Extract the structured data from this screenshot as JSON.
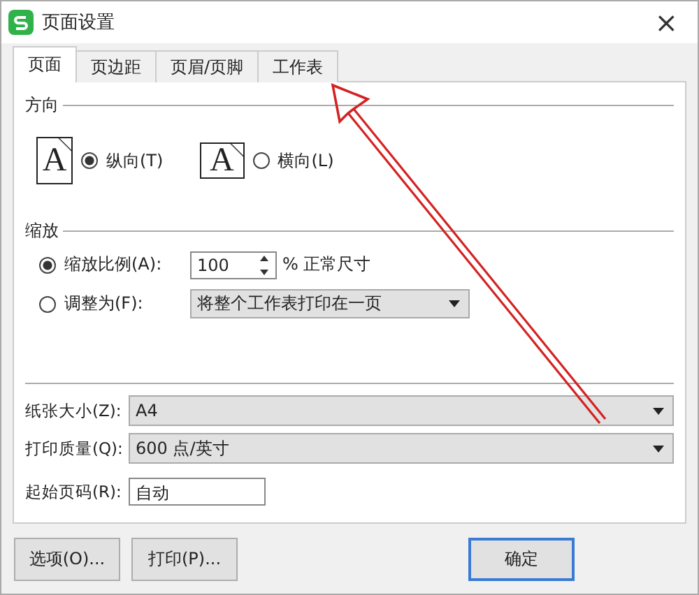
{
  "window": {
    "title": "页面设置",
    "close": "×"
  },
  "tabs": [
    {
      "label": "页面",
      "selected": true
    },
    {
      "label": "页边距",
      "selected": false
    },
    {
      "label": "页眉/页脚",
      "selected": false
    },
    {
      "label": "工作表",
      "selected": false
    }
  ],
  "orientation": {
    "title": "方向",
    "options": [
      {
        "kind": "portrait",
        "glyph": "A",
        "label": "纵向(T)",
        "selected": true
      },
      {
        "kind": "landscape",
        "glyph": "A",
        "label": "横向(L)",
        "selected": false
      }
    ]
  },
  "scaling": {
    "title": "缩放",
    "options": [
      {
        "kind": "percent",
        "label": "缩放比例(A):",
        "selected": true,
        "value": "100",
        "suffix": "% 正常尺寸"
      },
      {
        "kind": "fit",
        "label": "调整为(F):",
        "selected": false,
        "value": "将整个工作表打印在一页"
      }
    ]
  },
  "paper_size": {
    "label": "纸张大小(Z):",
    "value": "A4"
  },
  "print_quality": {
    "label": "打印质量(Q):",
    "value": "600 点/英寸"
  },
  "first_page_number": {
    "label": "起始页码(R):",
    "value": "自动"
  },
  "buttons": [
    {
      "kind": "plain",
      "label": "选项(O)..."
    },
    {
      "kind": "plain",
      "label": "打印(P)..."
    },
    {
      "kind": "default",
      "label": "确定"
    }
  ]
}
